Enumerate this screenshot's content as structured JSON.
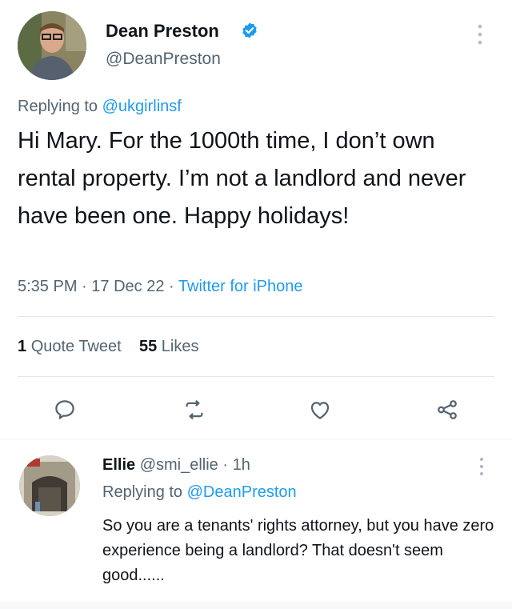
{
  "tweet": {
    "author_name": "Dean Preston",
    "author_handle": "@DeanPreston",
    "replying_label": "Replying to",
    "replying_to": "@ukgirlinsf",
    "text": "Hi Mary. For the 1000th time, I don’t own rental property. I’m not a landlord and never have been one. Happy holidays!",
    "time": "5:35 PM",
    "dot": "·",
    "date": "17 Dec 22",
    "source": "Twitter for iPhone",
    "quote_count": "1",
    "quote_label": "Quote Tweet",
    "like_count": "55",
    "like_label": "Likes"
  },
  "actions": [
    {
      "name": "reply",
      "icon": "comment-icon"
    },
    {
      "name": "retweet",
      "icon": "retweet-icon"
    },
    {
      "name": "like",
      "icon": "heart-icon"
    },
    {
      "name": "share",
      "icon": "share-icon"
    }
  ],
  "reply": {
    "author_name": "Ellie",
    "author_handle": "@smi_ellie",
    "dot": "·",
    "age": "1h",
    "replying_label": "Replying to",
    "replying_to": "@DeanPreston",
    "text": "So you are a tenants' rights attorney, but you have zero experience being a landlord? That doesn't seem good......"
  },
  "colors": {
    "link": "#1d9bf0",
    "secondary_text": "#536471",
    "primary_text": "#0f1419",
    "verified_badge": "#1d9bf0"
  }
}
